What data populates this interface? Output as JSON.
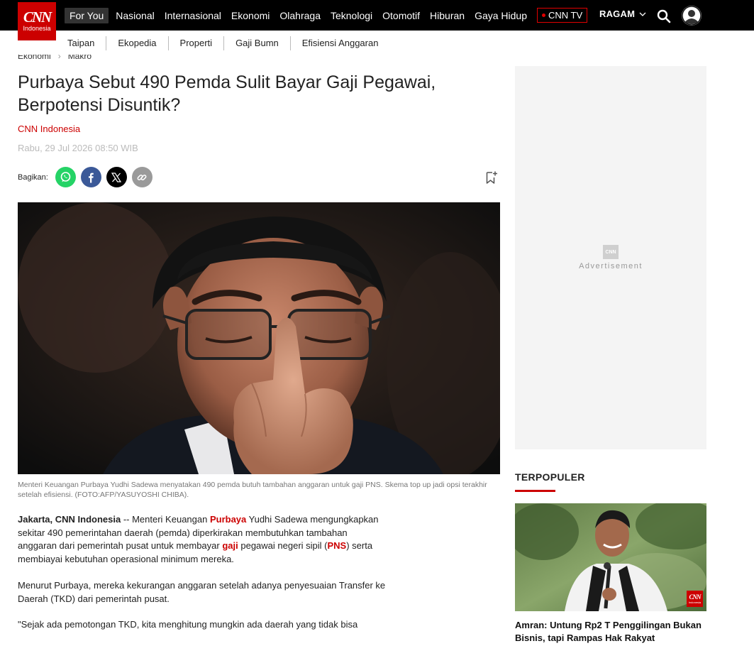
{
  "brand": {
    "logo_main": "CNN",
    "logo_sub": "Indonesia",
    "color": "#cc0000"
  },
  "nav": {
    "items": [
      "For You",
      "Nasional",
      "Internasional",
      "Ekonomi",
      "Olahraga",
      "Teknologi",
      "Otomotif",
      "Hiburan",
      "Gaya Hidup"
    ],
    "tv_label": "CNN TV",
    "ragam_label": "RAGAM"
  },
  "subnav": {
    "items": [
      "Taipan",
      "Ekopedia",
      "Properti",
      "Gaji Bumn",
      "Efisiensi Anggaran"
    ]
  },
  "breadcrumb": [
    "Ekonomi",
    "Makro"
  ],
  "article": {
    "title": "Purbaya Sebut 490 Pemda Sulit Bayar Gaji Pegawai, Berpotensi Disuntik?",
    "author": "CNN Indonesia",
    "date": "Rabu, 29 Jul 2026 08:50 WIB",
    "share_label": "Bagikan:",
    "caption": "Menteri Keuangan Purbaya Yudhi Sadewa menyatakan 490 pemda butuh tambahan anggaran untuk gaji PNS. Skema top up jadi opsi terakhir setelah efisiensi. (FOTO:AFP/YASUYOSHI CHIBA).",
    "p1": {
      "dateline": "Jakarta, CNN Indonesia",
      "t1": " -- Menteri Keuangan ",
      "k1": "Purbaya",
      "t2": " Yudhi Sadewa mengungkapkan sekitar 490 pemerintahan daerah (pemda) diperkirakan membutuhkan tambahan anggaran dari pemerintah pusat untuk membayar ",
      "k2": "gaji",
      "t3": " pegawai negeri sipil (",
      "k3": "PNS",
      "t4": ") serta membiayai kebutuhan operasional minimum mereka."
    },
    "p2": "Menurut Purbaya, mereka kekurangan anggaran setelah adanya penyesuaian Transfer ke Daerah (TKD) dari pemerintah pusat.",
    "p3": "\"Sejak ada pemotongan TKD, kita menghitung mungkin ada daerah yang tidak bisa"
  },
  "ad": {
    "label": "Advertisement",
    "logo": "CNN"
  },
  "popular": {
    "heading": "TERPOPULER",
    "item_title": "Amran: Untung Rp2 T Penggilingan Bukan Bisnis, tapi Rampas Hak Rakyat",
    "badge_main": "CNN",
    "badge_sub": "Indonesia"
  },
  "icons": [
    "whatsapp-icon",
    "facebook-icon",
    "x-icon",
    "link-icon",
    "bookmark-icon",
    "search-icon",
    "user-icon",
    "chevron-down-icon"
  ]
}
